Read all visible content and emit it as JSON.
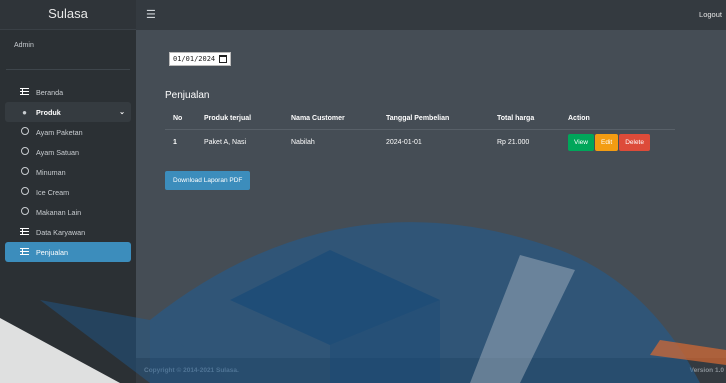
{
  "brand": "Sulasa",
  "user": "Admin",
  "topbar": {
    "logout": "Logout"
  },
  "sidebar": {
    "items": [
      {
        "label": "Beranda",
        "icon": "table-icon"
      },
      {
        "label": "Produk",
        "icon": "palette-icon"
      },
      {
        "label": "Ayam Paketan",
        "icon": "circle-icon"
      },
      {
        "label": "Ayam Satuan",
        "icon": "circle-icon"
      },
      {
        "label": "Minuman",
        "icon": "circle-icon"
      },
      {
        "label": "Ice Cream",
        "icon": "circle-icon"
      },
      {
        "label": "Makanan Lain",
        "icon": "circle-icon"
      },
      {
        "label": "Data Karyawan",
        "icon": "table-icon"
      },
      {
        "label": "Penjualan",
        "icon": "table-icon"
      }
    ]
  },
  "main": {
    "date_value": "01/01/2024",
    "section_title": "Penjualan",
    "columns": [
      "No",
      "Produk terjual",
      "Nama Customer",
      "Tanggal Pembelian",
      "Total harga",
      "Action"
    ],
    "rows": [
      {
        "no": "1",
        "produk": "Paket A, Nasi",
        "customer": "Nabilah",
        "tanggal": "2024-01-01",
        "total": "Rp 21.000"
      }
    ],
    "actions": {
      "view": "View",
      "edit": "Edit",
      "delete": "Delete"
    },
    "download_label": "Download Laporan PDF"
  },
  "footer": {
    "copyright": "Copyright © 2014-2021 Sulasa.",
    "version": "Version 1.0"
  },
  "colors": {
    "primary": "#3c8dbc",
    "success": "#00a65a",
    "warning": "#f39c12",
    "danger": "#dd4b39",
    "watermark": "#1f5d94"
  }
}
